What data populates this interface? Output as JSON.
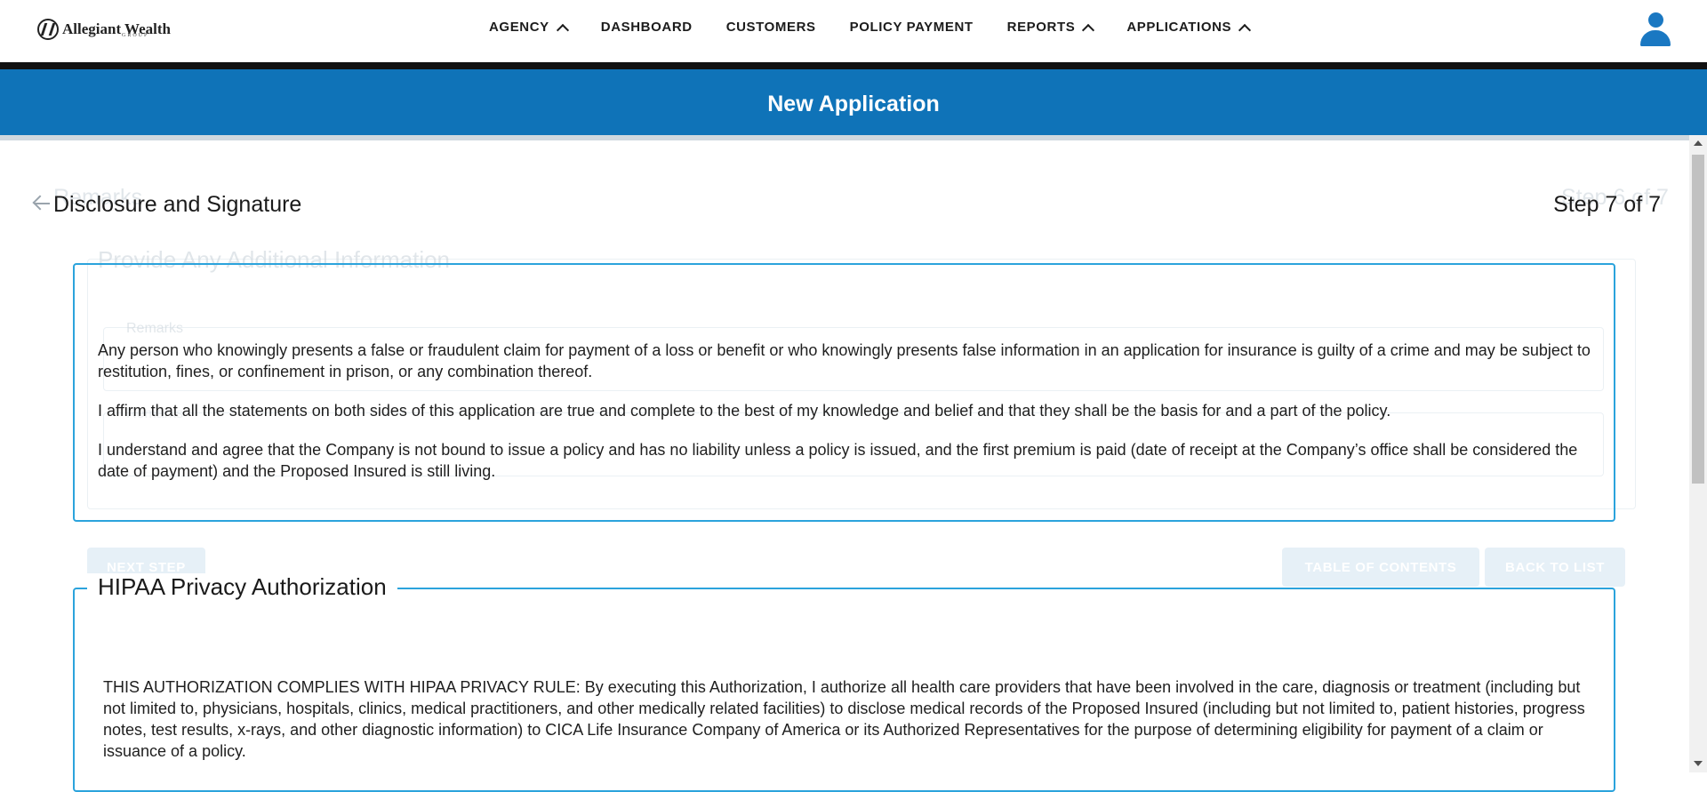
{
  "brand": {
    "name": "Allegiant Wealth",
    "sub": "GROUP"
  },
  "nav": {
    "items": [
      {
        "label": "AGENCY",
        "has_menu": true
      },
      {
        "label": "DASHBOARD",
        "has_menu": false
      },
      {
        "label": "CUSTOMERS",
        "has_menu": false
      },
      {
        "label": "POLICY PAYMENT",
        "has_menu": false
      },
      {
        "label": "REPORTS",
        "has_menu": true
      },
      {
        "label": "APPLICATIONS",
        "has_menu": true
      }
    ],
    "user_icon": "user-icon"
  },
  "page": {
    "title": "New Application"
  },
  "background_step": {
    "title": "Remarks",
    "step": "Step 6 of 7",
    "legend": "Provide Any Additional Information",
    "field_label": "Remarks",
    "field_label_2": "Remarks",
    "next_button": "NEXT STEP",
    "toc_button": "TABLE OF CONTENTS",
    "back_button": "BACK TO LIST"
  },
  "step": {
    "title": "Disclosure and Signature",
    "label": "Step 7 of 7"
  },
  "disclosure": {
    "paragraphs": [
      "Any person who knowingly presents a false or fraudulent claim for payment of a loss or benefit or who knowingly presents false information in an application for insurance is guilty of a crime and may be subject to restitution, fines, or confinement in prison, or any combination thereof.",
      "I affirm that all the statements on both sides of this application are true and complete to the best of my knowledge and belief and that they shall be the basis for and a part of the policy.",
      "I understand and agree that the Company is not bound to issue a policy and has no liability unless a policy is issued, and the first premium is paid (date of receipt at the Company’s office shall be considered the date of payment) and the Proposed Insured is still living."
    ]
  },
  "hipaa": {
    "legend": "HIPAA Privacy Authorization",
    "text": "THIS AUTHORIZATION COMPLIES WITH HIPAA PRIVACY RULE: By executing this Authorization, I authorize all health care providers that have been involved in the care, diagnosis or treatment (including but not limited to, physicians, hospitals, clinics, medical practitioners, and other medically related facilities) to disclose medical records of the Proposed Insured (including but not limited to, patient histories, progress notes, test results, x-rays, and other diagnostic information) to CICA Life Insurance Company of America or its Authorized Representatives for the purpose of determining eligibility for payment of a claim or issuance of a policy."
  },
  "colors": {
    "primary": "#0f73b8",
    "accent_border": "#2ba3dc",
    "user_icon": "#1a78c2"
  }
}
